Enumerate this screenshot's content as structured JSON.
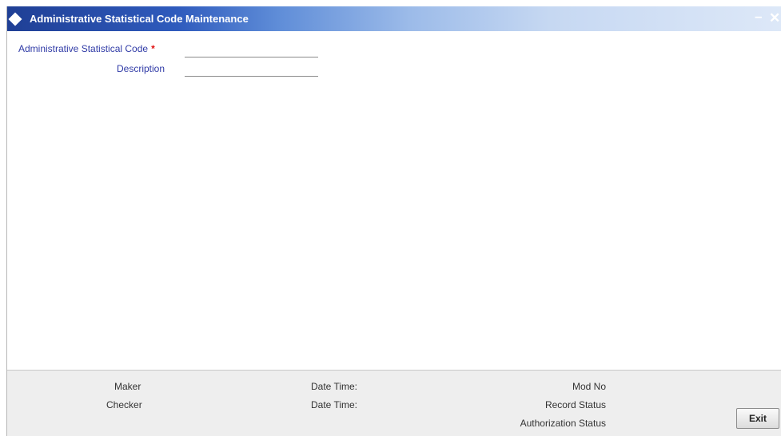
{
  "window": {
    "title": "Administrative Statistical Code Maintenance",
    "minimize_glyph": "–",
    "close_glyph": "✕"
  },
  "form": {
    "code_label": "Administrative Statistical Code",
    "required_marker": "*",
    "code_value": "",
    "description_label": "Description",
    "description_value": ""
  },
  "footer": {
    "maker_label": "Maker",
    "checker_label": "Checker",
    "maker_datetime_label": "Date Time:",
    "checker_datetime_label": "Date Time:",
    "mod_no_label": "Mod No",
    "record_status_label": "Record Status",
    "authorization_status_label": "Authorization Status",
    "maker_value": "",
    "checker_value": "",
    "maker_datetime_value": "",
    "checker_datetime_value": "",
    "mod_no_value": "",
    "record_status_value": "",
    "authorization_status_value": ""
  },
  "actions": {
    "exit_label": "Exit"
  }
}
